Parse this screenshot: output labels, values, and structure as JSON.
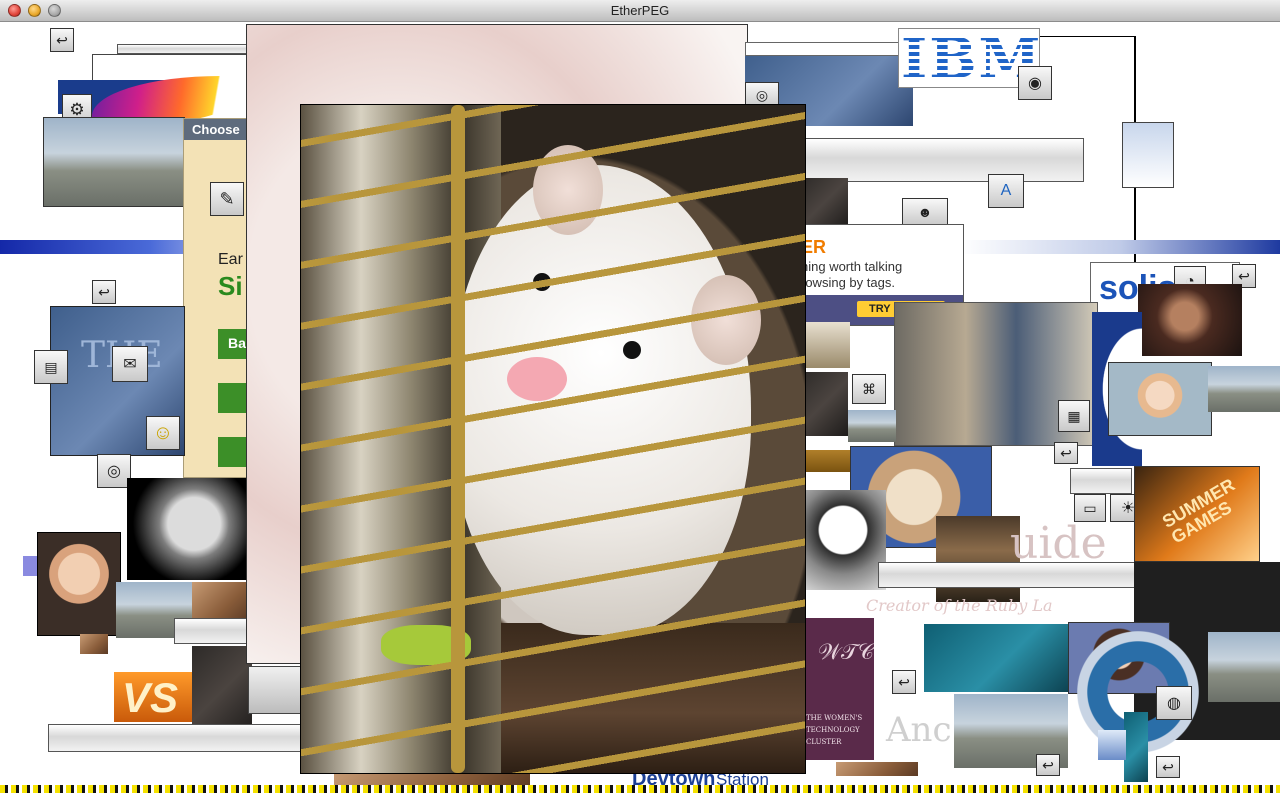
{
  "window": {
    "title": "EtherPEG"
  },
  "collage": {
    "ibm_logo": "IBM",
    "solis_logo": "solis",
    "ad": {
      "headline_fragment": "ER",
      "line1": "hing worth talking",
      "line2": "rowsing by tags.",
      "button": "TRY IT NOW"
    },
    "sidebar_fragments": {
      "choose": "Choose",
      "ear": "Ear",
      "si": "Si",
      "ba": "Ba"
    },
    "tab_fragment": "Ch",
    "summer_games": "SUMMER GAMES",
    "guide_fragment": "uide",
    "ruby_fragment": "Creator of the Ruby La",
    "and_fragment": "Anc",
    "wtc": {
      "lines": [
        "THE WOMEN'S",
        "TECHNOLOGY",
        "CLUSTER"
      ]
    },
    "vs_text": "VS",
    "devtown": {
      "dev": "Devtown",
      "station": "Station"
    },
    "the_fragment": "THE"
  }
}
